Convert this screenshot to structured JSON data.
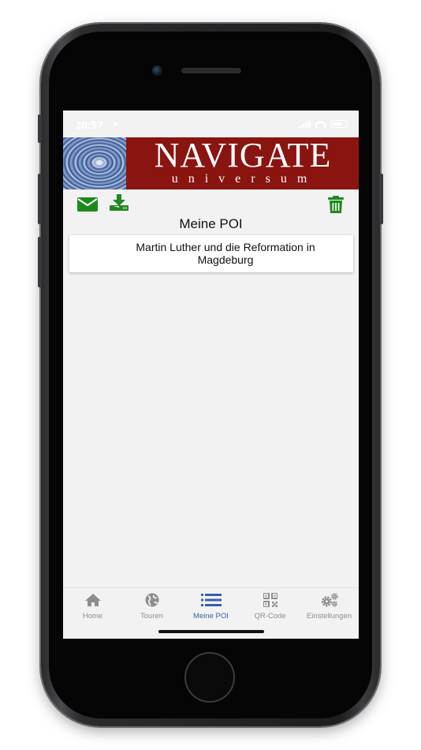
{
  "status_bar": {
    "time": "20:57"
  },
  "banner": {
    "title": "NAVIGATE",
    "subtitle": "universum"
  },
  "page": {
    "title": "Meine POI"
  },
  "poi_list": [
    {
      "title": "Martin Luther und die Reformation in Magdeburg"
    }
  ],
  "tabs": [
    {
      "label": "Home",
      "icon": "home-icon"
    },
    {
      "label": "Touren",
      "icon": "globe-icon"
    },
    {
      "label": "Meine POI",
      "icon": "list-icon"
    },
    {
      "label": "QR-Code",
      "icon": "qr-code-icon"
    },
    {
      "label": "Einstellungen",
      "icon": "gears-icon"
    }
  ],
  "colors": {
    "accent_green": "#1e8a1e",
    "banner_red": "#8a1410",
    "tab_active": "#3a5fa8",
    "tab_inactive": "#8e8e8e"
  }
}
